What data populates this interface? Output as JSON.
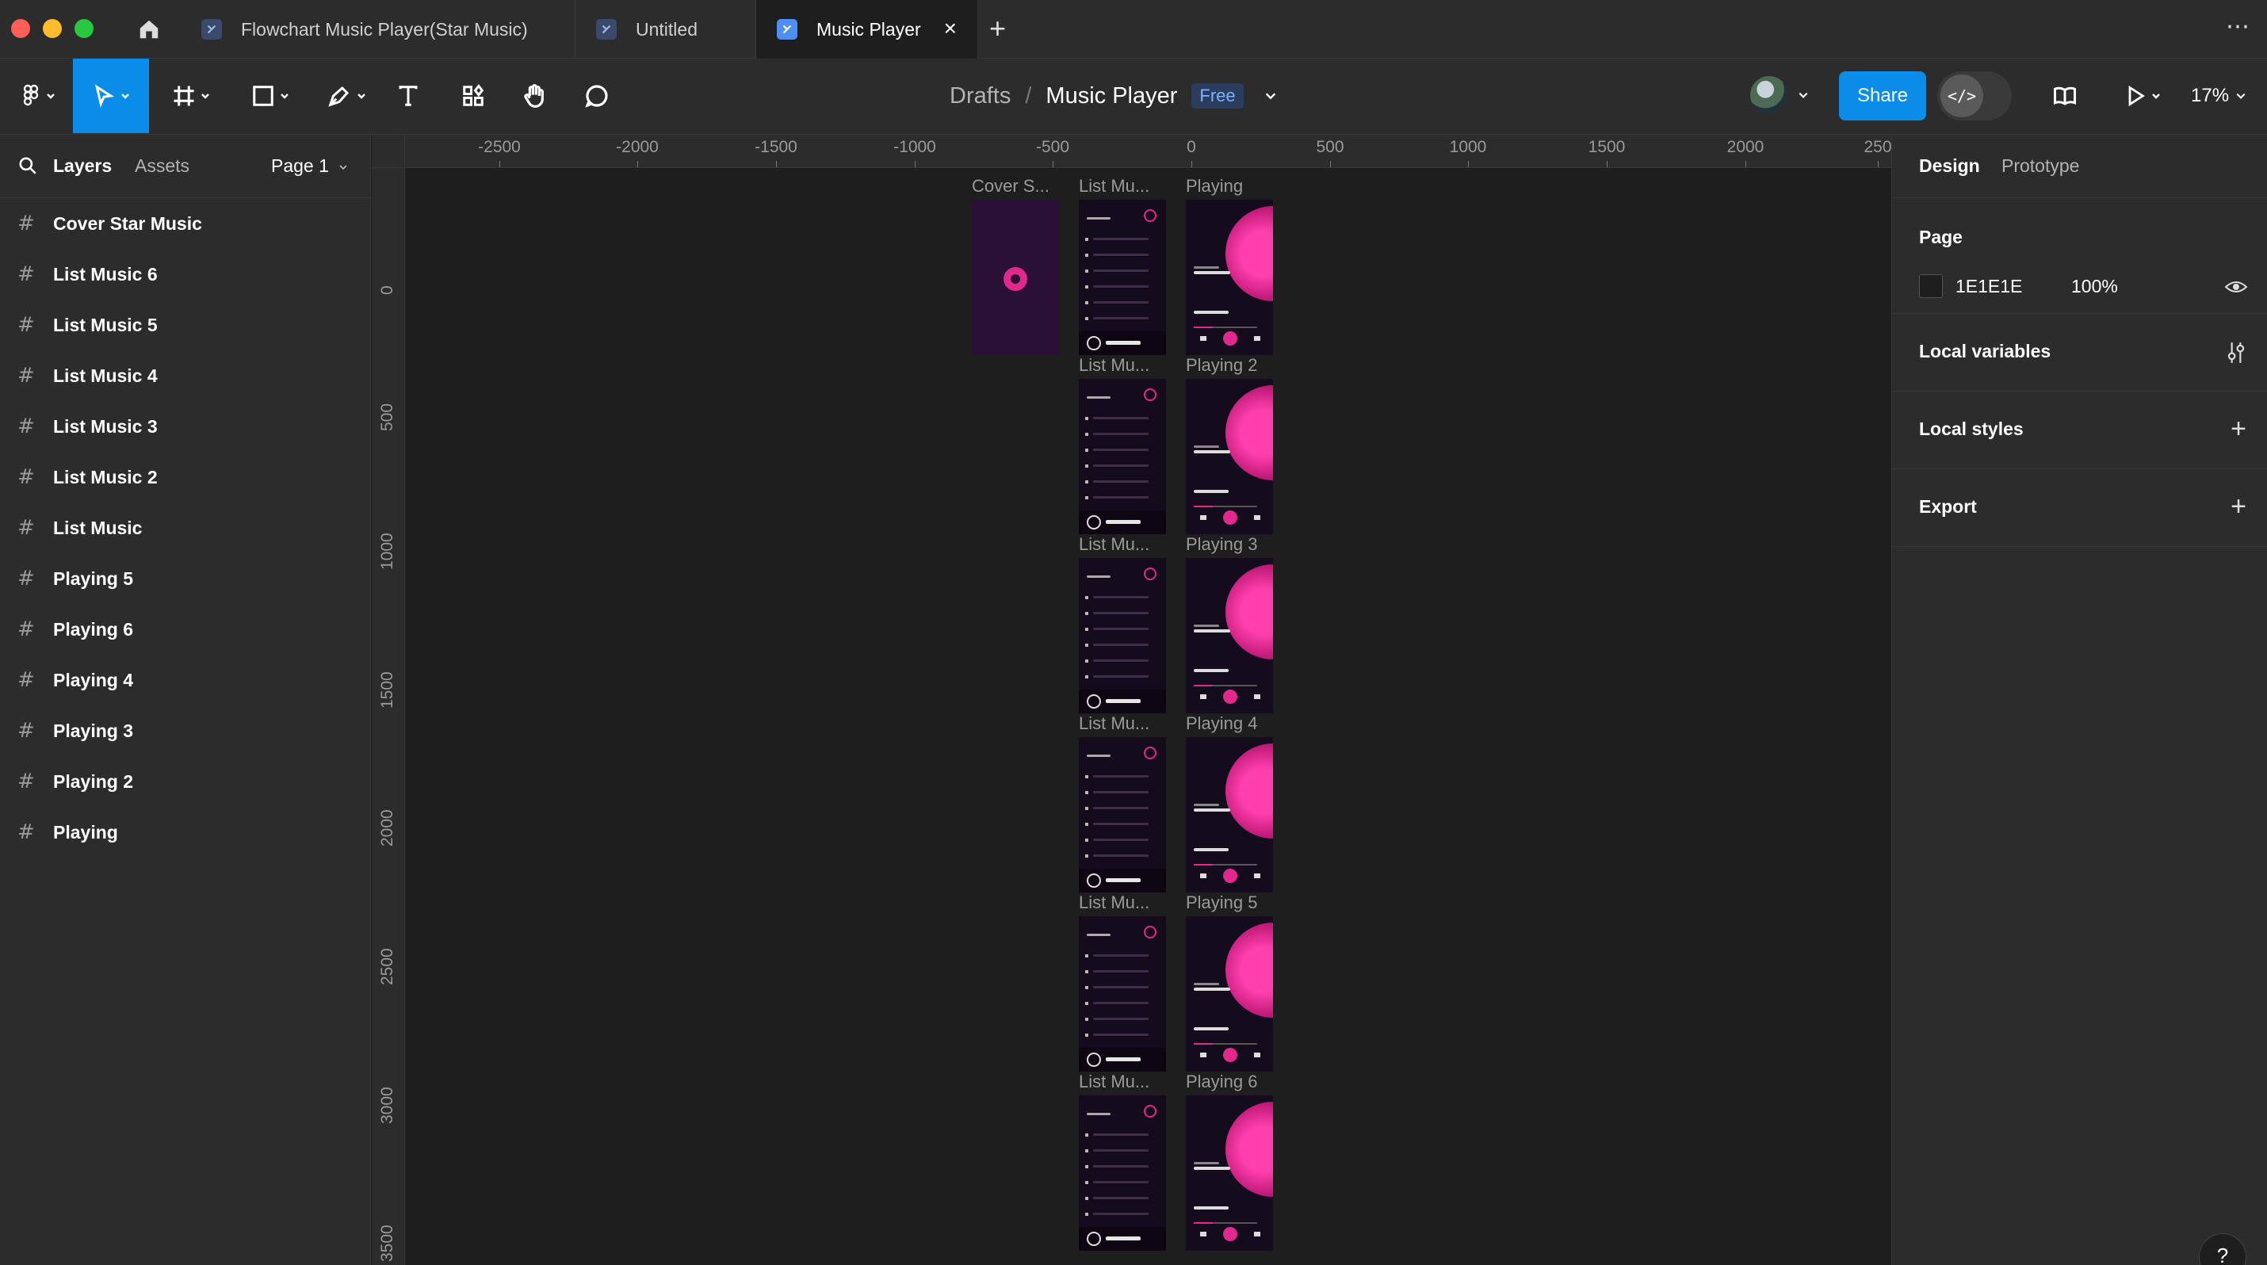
{
  "window": {
    "tabs": [
      {
        "label": "Flowchart Music Player(Star Music)",
        "active": false
      },
      {
        "label": "Untitled",
        "active": false
      },
      {
        "label": "Music Player",
        "active": true
      }
    ],
    "close_icon": "×",
    "new_tab_icon": "+",
    "more_icon": "⋯"
  },
  "toolbar": {
    "breadcrumb_root": "Drafts",
    "breadcrumb_sep": "/",
    "file_name": "Music Player",
    "plan_badge": "Free",
    "share_label": "Share",
    "dev_mode_icon": "</>",
    "zoom": "17%"
  },
  "left_panel": {
    "tab_layers": "Layers",
    "tab_assets": "Assets",
    "page_selector": "Page 1",
    "layers": [
      "Cover Star Music",
      "List Music 6",
      "List Music 5",
      "List Music 4",
      "List Music 3",
      "List Music 2",
      "List Music",
      "Playing 5",
      "Playing 6",
      "Playing 4",
      "Playing 3",
      "Playing 2",
      "Playing"
    ]
  },
  "canvas": {
    "ruler_top": [
      "-2500",
      "-2000",
      "-1500",
      "-1000",
      "-500",
      "0",
      "500",
      "1000",
      "1500",
      "2000",
      "250"
    ],
    "ruler_left": [
      "0",
      "500",
      "1000",
      "1500",
      "2000",
      "2500",
      "3000",
      "3500"
    ],
    "frame_labels": {
      "cover": "Cover S...",
      "list": [
        "List Mu...",
        "List Mu...",
        "List Mu...",
        "List Mu...",
        "List Mu...",
        "List Mu..."
      ],
      "playing": [
        "Playing",
        "Playing 2",
        "Playing 3",
        "Playing 4",
        "Playing 5",
        "Playing 6"
      ]
    },
    "colors": {
      "frame_bg": "#140c1d",
      "accent": "#e2288a",
      "cover_bg": "#2a0f36"
    }
  },
  "right_panel": {
    "tab_design": "Design",
    "tab_prototype": "Prototype",
    "page_title": "Page",
    "page_color": "1E1E1E",
    "page_opacity": "100%",
    "local_variables": "Local variables",
    "local_styles": "Local styles",
    "export": "Export",
    "help_label": "?"
  }
}
